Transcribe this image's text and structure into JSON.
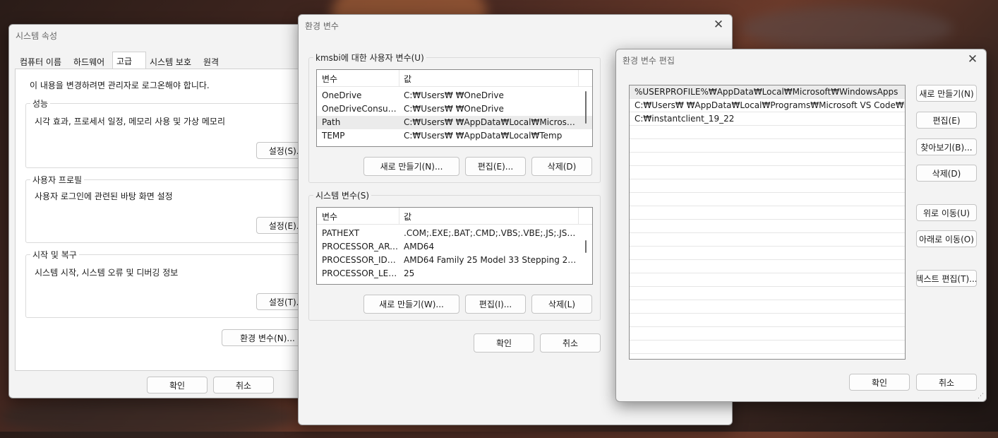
{
  "system_properties": {
    "title": "시스템 속성",
    "tabs": [
      {
        "label": "컴퓨터 이름"
      },
      {
        "label": "하드웨어"
      },
      {
        "label": "고급"
      },
      {
        "label": "시스템 보호"
      },
      {
        "label": "원격"
      }
    ],
    "admin_note": "이 내용을 변경하려면 관리자로 로그온해야 합니다.",
    "performance": {
      "label": "성능",
      "desc": "시각 효과, 프로세서 일정, 메모리 사용 및 가상 메모리",
      "button": "설정(S)..."
    },
    "user_profile": {
      "label": "사용자 프로필",
      "desc": "사용자 로그인에 관련된 바탕 화면 설정",
      "button": "설정(E)..."
    },
    "startup": {
      "label": "시작 및 복구",
      "desc": "시스템 시작, 시스템 오류 및 디버깅 정보",
      "button": "설정(T)..."
    },
    "env_button": "환경 변수(N)...",
    "ok": "확인",
    "cancel": "취소"
  },
  "env_vars": {
    "title": "환경 변수",
    "user_group": "kmsbi에 대한 사용자 변수(U)",
    "col_var": "변수",
    "col_val": "값",
    "user_rows": [
      {
        "name": "OneDrive",
        "value": "C:₩Users₩        ₩OneDrive"
      },
      {
        "name": "OneDriveConsumer",
        "value": "C:₩Users₩        ₩OneDrive"
      },
      {
        "name": "Path",
        "value": "C:₩Users₩        ₩AppData₩Local₩Microso..."
      },
      {
        "name": "TEMP",
        "value": "C:₩Users₩        ₩AppData₩Local₩Temp"
      }
    ],
    "user_new": "새로 만들기(N)...",
    "user_edit": "편집(E)...",
    "user_delete": "삭제(D)",
    "sys_group": "시스템 변수(S)",
    "sys_rows": [
      {
        "name": "PATHEXT",
        "value": ".COM;.EXE;.BAT;.CMD;.VBS;.VBE;.JS;.JSE;.W..."
      },
      {
        "name": "PROCESSOR_ARC...",
        "value": "AMD64"
      },
      {
        "name": "PROCESSOR_IDEN...",
        "value": "AMD64 Family 25 Model 33 Stepping 2, A..."
      },
      {
        "name": "PROCESSOR_LEVEL",
        "value": "25"
      }
    ],
    "sys_new": "새로 만들기(W)...",
    "sys_edit": "편집(I)...",
    "sys_delete": "삭제(L)",
    "ok": "확인",
    "cancel": "취소"
  },
  "edit_env": {
    "title": "환경 변수 편집",
    "entries": [
      "%USERPROFILE%₩AppData₩Local₩Microsoft₩WindowsApps",
      "C:₩Users₩        ₩AppData₩Local₩Programs₩Microsoft VS Code₩bin",
      "C:₩instantclient_19_22"
    ],
    "btn_new": "새로 만들기(N)",
    "btn_edit": "편집(E)",
    "btn_browse": "찾아보기(B)...",
    "btn_delete": "삭제(D)",
    "btn_up": "위로 이동(U)",
    "btn_down": "아래로 이동(O)",
    "btn_text": "텍스트 편집(T)...",
    "ok": "확인",
    "cancel": "취소"
  }
}
